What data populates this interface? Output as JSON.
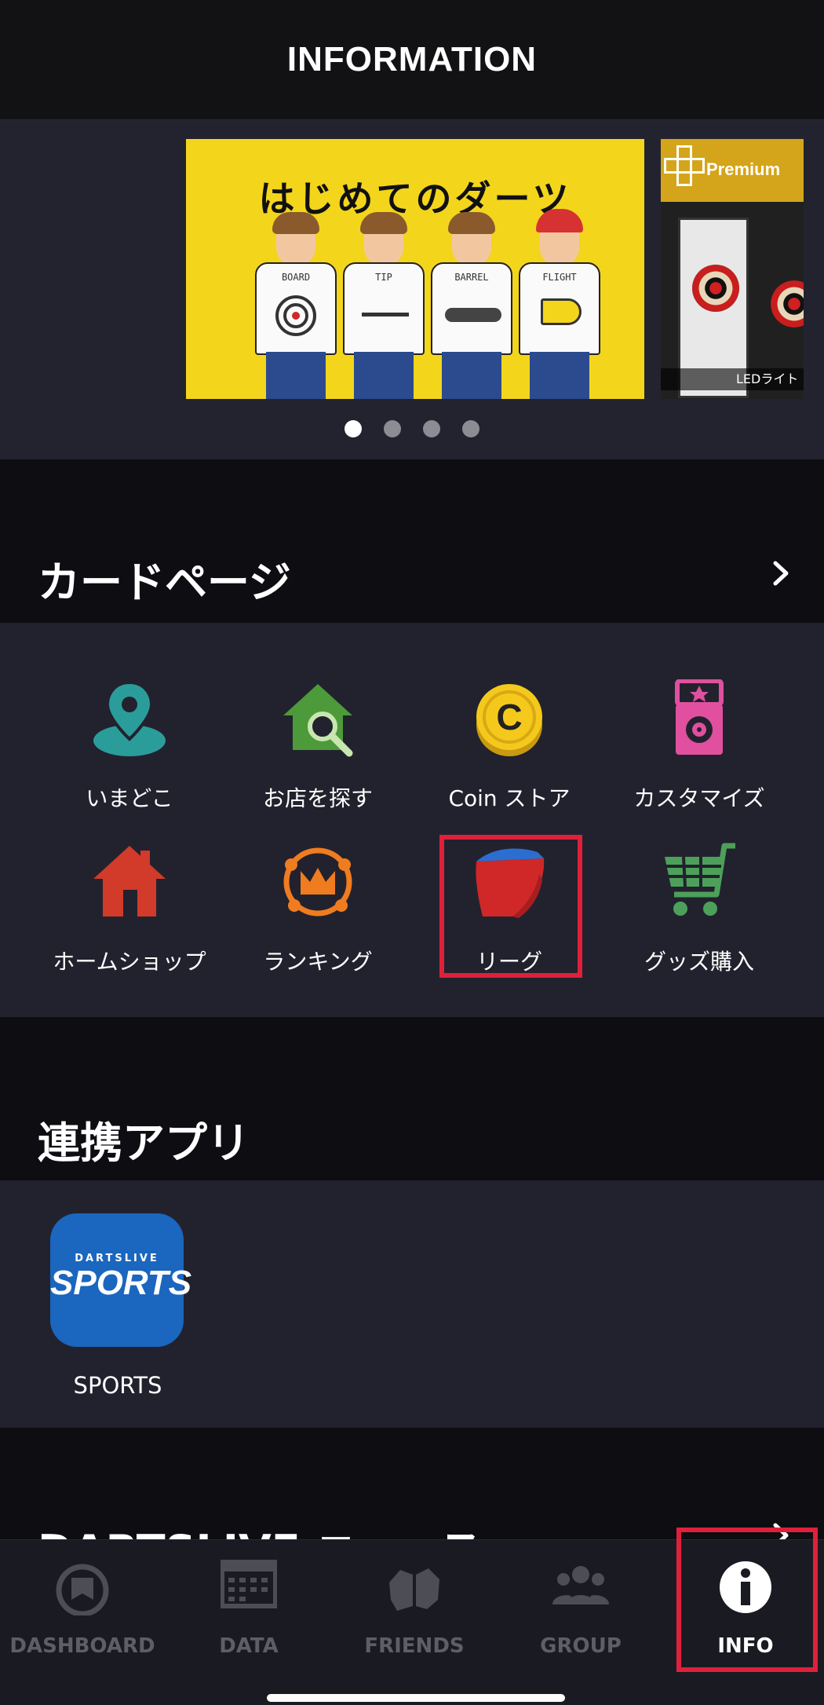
{
  "header": {
    "title": "INFORMATION"
  },
  "banners": {
    "main": {
      "title": "はじめてのダーツ",
      "shirts": [
        "BOARD",
        "TIP",
        "BARREL",
        "FLIGHT"
      ]
    },
    "second": {
      "title": "Premium",
      "plus_label": "Plus",
      "caption": "LEDライト"
    },
    "page_count": 4,
    "active_page": 1
  },
  "card_page": {
    "title": "カードページ",
    "items": [
      {
        "label": "いまどこ",
        "icon": "map-pin-icon",
        "color": "#2a9d9a"
      },
      {
        "label": "お店を探す",
        "icon": "shop-search-icon",
        "color": "#4d9a3a"
      },
      {
        "label": "Coin ストア",
        "icon": "coin-icon",
        "color": "#f5c91c"
      },
      {
        "label": "カスタマイズ",
        "icon": "customize-icon",
        "color": "#e0509e"
      },
      {
        "label": "ホームショップ",
        "icon": "home-shop-icon",
        "color": "#d23a2a"
      },
      {
        "label": "ランキング",
        "icon": "ranking-crown-icon",
        "color": "#f07c20"
      },
      {
        "label": "リーグ",
        "icon": "league-flight-icon",
        "color": "#d02828"
      },
      {
        "label": "グッズ購入",
        "icon": "shopping-cart-icon",
        "color": "#4da05a"
      }
    ]
  },
  "linked_apps": {
    "title": "連携アプリ",
    "apps": [
      {
        "label": "SPORTS",
        "tile_small": "DARTSLIVE",
        "tile_big": "SPORTS",
        "color": "#1b66be"
      }
    ]
  },
  "next_section": {
    "title": "DARTSLIVE ニュース"
  },
  "tab_bar": {
    "tabs": [
      {
        "label": "DASHBOARD",
        "icon": "dashboard-icon"
      },
      {
        "label": "DATA",
        "icon": "data-calendar-icon"
      },
      {
        "label": "FRIENDS",
        "icon": "friends-icon"
      },
      {
        "label": "GROUP",
        "icon": "group-icon"
      },
      {
        "label": "INFO",
        "icon": "info-icon"
      }
    ],
    "active": "INFO"
  },
  "highlight_color": "#e0203a"
}
